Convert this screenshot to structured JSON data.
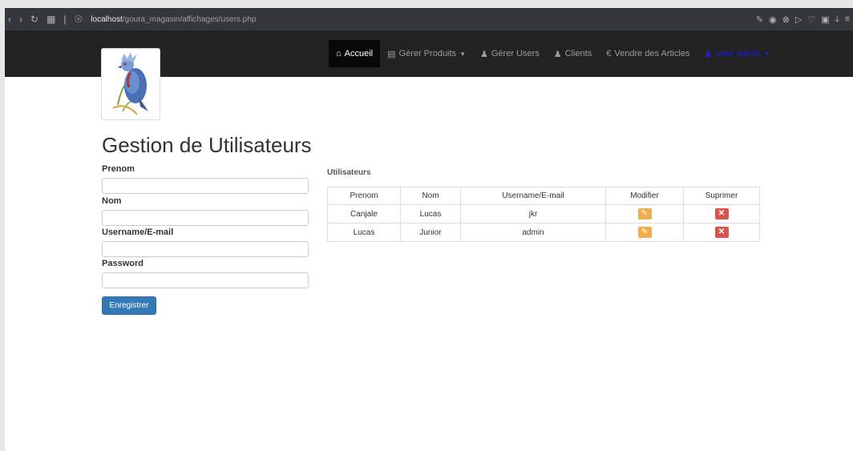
{
  "browser": {
    "url_host": "localhost",
    "url_path": "/goura_magasin/affichages/users.php"
  },
  "nav": {
    "items": [
      {
        "label": "Accueil",
        "icon": "home-icon",
        "active": true
      },
      {
        "label": "Gérer Produits",
        "icon": "list-icon",
        "dropdown": true
      },
      {
        "label": "Gérer Users",
        "icon": "user-icon"
      },
      {
        "label": "Clients",
        "icon": "user-icon"
      },
      {
        "label": "Vendre des Articles",
        "icon": "euro-icon"
      }
    ],
    "user_label": "User admin",
    "user_color": "#1e1ee0"
  },
  "page_title": "Gestion de Utilisateurs",
  "form": {
    "prenom_label": "Prenom",
    "nom_label": "Nom",
    "username_label": "Username/E-mail",
    "password_label": "Password",
    "submit_label": "Enregistrer"
  },
  "users_table": {
    "title": "Utilisateurs",
    "headers": [
      "Prenom",
      "Nom",
      "Username/E-mail",
      "Modifier",
      "Suprimer"
    ],
    "rows": [
      {
        "prenom": "Canjale",
        "nom": "Lucas",
        "username": "jkr"
      },
      {
        "prenom": "Lucas",
        "nom": "Junior",
        "username": "admin"
      }
    ]
  },
  "colors": {
    "primary": "#337ab7",
    "warning": "#f0ad4e",
    "danger": "#d9534f",
    "navbar": "#222222"
  }
}
